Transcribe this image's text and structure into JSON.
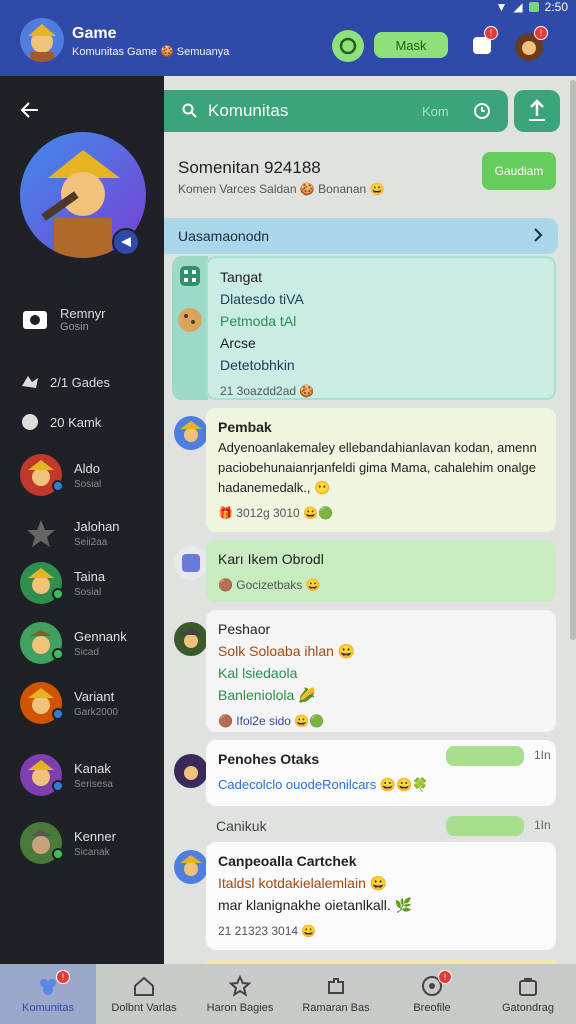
{
  "status": {
    "time": "2:50"
  },
  "header": {
    "title": "Game",
    "subtitle": "Komunitas Game 🍪 Semuanya",
    "pill_label": "Mask",
    "notif_count_1": "!",
    "notif_count_2": "!"
  },
  "sidebar": {
    "menu": [
      {
        "label": "Remnyr",
        "sub": "Gosin"
      },
      {
        "label": "2/1  Gades"
      },
      {
        "label": "20  Kamk"
      }
    ],
    "friends": [
      {
        "name": "Aldo",
        "status": "Sosial"
      },
      {
        "name": "Jalohan",
        "status": "Seii2aa"
      },
      {
        "name": "Taina",
        "status": "Sosial"
      },
      {
        "name": "Gennank",
        "status": "Sicad"
      },
      {
        "name": "Variant",
        "status": "Gark2000"
      },
      {
        "name": "Kanak",
        "status": "Serisesa"
      },
      {
        "name": "Kenner",
        "status": "Sicanak"
      }
    ]
  },
  "main": {
    "search": {
      "placeholder": "Komunitas",
      "hint": "Kom"
    },
    "group": {
      "title": "Somenitan 924188",
      "subtitle": "Komen Varces Saldan 🍪 Bonanan 😀",
      "join_label": "Gaudiam"
    },
    "section_title": "Uasamaonodn",
    "messages": [
      {
        "lines": [
          "Tangat",
          "Dlatesdo tiVA",
          "Petmoda tAl",
          "Arcse",
          "Detetobhkin"
        ],
        "footer": "21 3oazdd2ad 🍪"
      },
      {
        "author": "Pembak",
        "text": "Adyenoanlakemaley ellebandahianlavan kodan, amenn paciobehunaianrjanfeldi gima Mama, cahalehim onalge hadanemedalk., 😶",
        "footer": "🎁 3012g 3010 😀🟢"
      },
      {
        "author": "Karı Ikem Obrodl",
        "footer": "🟤 Gocizetbaks 😀"
      },
      {
        "author": "Peshaor",
        "lines": [
          "Solk Soloaba ihlan 😀",
          "Kal lsiedaola",
          "Banleniolola 🌽"
        ],
        "footer": "🟤 Ifol2e sido 😀🟢"
      },
      {
        "author": "Penohes Otaks",
        "time": "1In",
        "footer": "Cadecolclo ouodeRonilcars 😀😀🍀"
      },
      {
        "author": "Canpeoalla Cartchek",
        "lines": [
          "Italdsl kotdakielalemlain 😀",
          "mar klanignakhe oietanlkall. 🌿"
        ],
        "footer": "21 21323 3014 😀"
      }
    ],
    "divider": {
      "label": "Canikuk",
      "time": "1In"
    }
  },
  "bottomnav": [
    {
      "label": "Komunitas",
      "active": true
    },
    {
      "label": "Dolbnt Varlas"
    },
    {
      "label": "Haron Bagies"
    },
    {
      "label": "Ramaran Bas"
    },
    {
      "label": "Breofile"
    },
    {
      "label": "Gatondrag"
    }
  ]
}
